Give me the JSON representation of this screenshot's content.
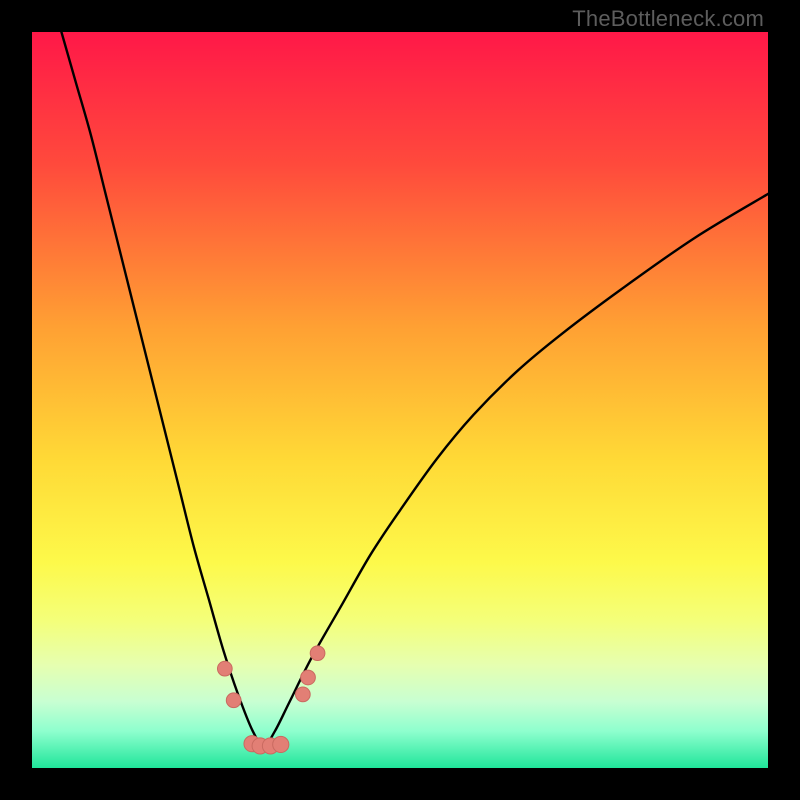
{
  "watermark": "TheBottleneck.com",
  "colors": {
    "frame": "#000000",
    "curve": "#000000",
    "marker_fill": "#e27f75",
    "marker_stroke": "#c96a60",
    "gradient_stops": [
      {
        "pct": 0,
        "color": "#ff1848"
      },
      {
        "pct": 18,
        "color": "#ff4a3c"
      },
      {
        "pct": 40,
        "color": "#ffa033"
      },
      {
        "pct": 58,
        "color": "#ffd936"
      },
      {
        "pct": 72,
        "color": "#fdf94a"
      },
      {
        "pct": 80,
        "color": "#f4ff7a"
      },
      {
        "pct": 86,
        "color": "#e6ffb0"
      },
      {
        "pct": 91,
        "color": "#c8ffd2"
      },
      {
        "pct": 95,
        "color": "#8effce"
      },
      {
        "pct": 100,
        "color": "#1fe59a"
      }
    ]
  },
  "chart_data": {
    "type": "line",
    "title": "",
    "xlabel": "",
    "ylabel": "",
    "xlim": [
      0,
      100
    ],
    "ylim": [
      0,
      100
    ],
    "notes": "V-shaped bottleneck curve; minimum (zero bottleneck) around x≈31. Axes have no tick labels.",
    "series": [
      {
        "name": "bottleneck-curve",
        "x": [
          4,
          6,
          8,
          10,
          12,
          14,
          16,
          18,
          20,
          22,
          24,
          26,
          28,
          30,
          31.5,
          33,
          35,
          38,
          42,
          46,
          50,
          55,
          60,
          66,
          72,
          80,
          90,
          100
        ],
        "y": [
          100,
          93,
          86,
          78,
          70,
          62,
          54,
          46,
          38,
          30,
          23,
          16,
          10,
          5,
          3,
          5,
          9,
          15,
          22,
          29,
          35,
          42,
          48,
          54,
          59,
          65,
          72,
          78
        ]
      }
    ],
    "markers": [
      {
        "x": 26.2,
        "y": 13.5,
        "r": 1.0
      },
      {
        "x": 27.4,
        "y": 9.2,
        "r": 1.0
      },
      {
        "x": 29.9,
        "y": 3.3,
        "r": 1.1
      },
      {
        "x": 31.0,
        "y": 3.0,
        "r": 1.1
      },
      {
        "x": 32.4,
        "y": 3.0,
        "r": 1.1
      },
      {
        "x": 33.8,
        "y": 3.2,
        "r": 1.1
      },
      {
        "x": 36.8,
        "y": 10.0,
        "r": 1.0
      },
      {
        "x": 37.5,
        "y": 12.3,
        "r": 1.0
      },
      {
        "x": 38.8,
        "y": 15.6,
        "r": 1.0
      }
    ]
  }
}
